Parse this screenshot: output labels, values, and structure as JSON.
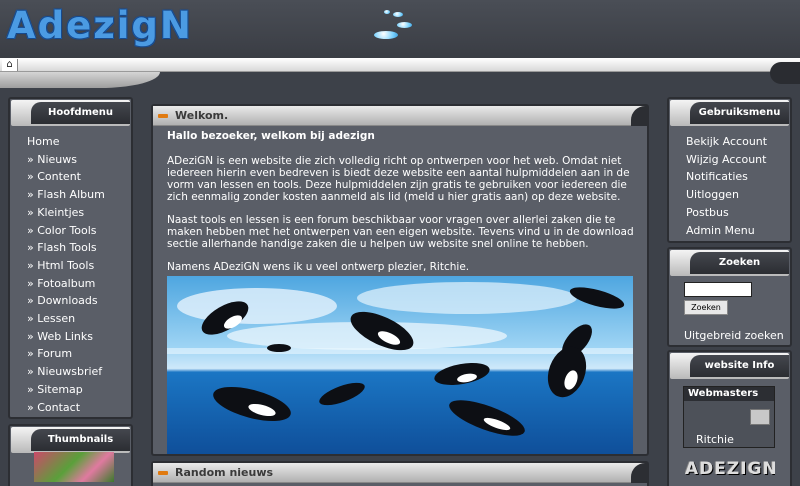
{
  "site": {
    "logo_text": "AdezigN"
  },
  "left_menu": {
    "title": "Hoofdmenu",
    "items": [
      "Home",
      "» Nieuws",
      "» Content",
      "» Flash Album",
      "» Kleintjes",
      "» Color Tools",
      "» Flash Tools",
      "» Html Tools",
      "» Fotoalbum",
      "» Downloads",
      "» Lessen",
      "» Web Links",
      "» Forum",
      "» Nieuwsbrief",
      "» Sitemap",
      "» Contact"
    ]
  },
  "thumbnails": {
    "title": "Thumbnails"
  },
  "welcome": {
    "title": "Welkom.",
    "greeting": "Hallo bezoeker, welkom bij adezign",
    "para1": "ADeziGN is een website die zich volledig richt op ontwerpen voor het web. Omdat niet iedereen hierin even bedreven is biedt deze website een aantal hulpmiddelen aan in de vorm van lessen en tools. Deze hulpmiddelen zijn gratis te gebruiken voor iedereen die zich eenmalig zonder kosten aanmeld als lid (meld u hier gratis aan) op deze website.",
    "para2": "Naast tools en lessen is een forum beschikbaar voor vragen over allerlei zaken die te maken hebben met het ontwerpen van een eigen website. Tevens vind u in de download sectie allerhande handige zaken die u helpen uw website snel online te hebben.",
    "para3": "Namens ADeziGN wens ik u veel ontwerp plezier, Ritchie."
  },
  "random_news": {
    "title": "Random nieuws"
  },
  "user_menu": {
    "title": "Gebruiksmenu",
    "items": [
      "Bekijk Account",
      "Wijzig Account",
      "Notificaties",
      "Uitloggen",
      "Postbus",
      "Admin Menu"
    ]
  },
  "search": {
    "title": "Zoeken",
    "input_value": "",
    "button_label": "Zoeken",
    "advanced_label": "Uitgebreid zoeken"
  },
  "website_info": {
    "title": "website Info",
    "webmasters_label": "Webmasters",
    "webmaster_name": "Ritchie",
    "promo_text": "ADEZIGN"
  },
  "colors": {
    "background": "#3d4149",
    "panel": "#5a5e67",
    "logo_blue": "#4b9be3",
    "accent_orange": "#e07a10"
  },
  "icons": {
    "home": "home-icon",
    "user_tool": "tool-icon"
  }
}
